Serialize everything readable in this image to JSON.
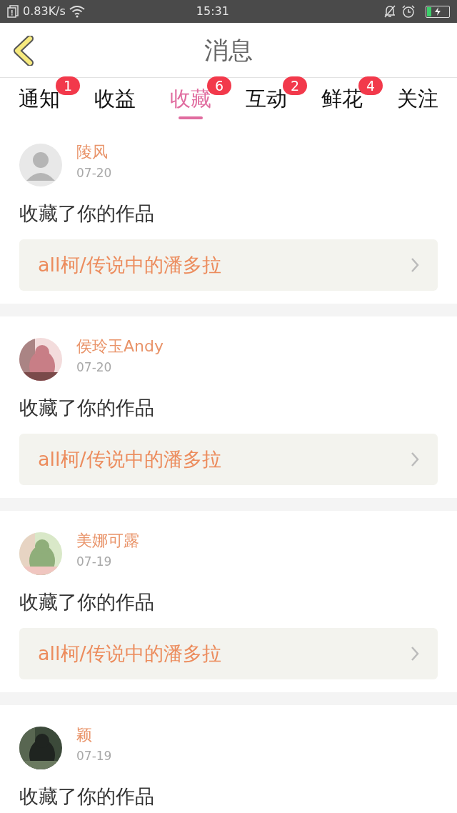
{
  "status_bar": {
    "speed": "0.83K/s",
    "time": "15:31"
  },
  "header": {
    "title": "消息"
  },
  "tabs": [
    {
      "label": "通知",
      "badge": "1",
      "selected": false
    },
    {
      "label": "收益",
      "selected": false
    },
    {
      "label": "收藏",
      "badge": "6",
      "selected": true
    },
    {
      "label": "互动",
      "badge": "2",
      "selected": false
    },
    {
      "label": "鲜花",
      "badge": "4",
      "selected": false
    },
    {
      "label": "关注",
      "selected": false
    }
  ],
  "messages": [
    {
      "avatar": {
        "kind": "silhouette"
      },
      "name": "陵风",
      "date": "07-20",
      "text": "收藏了你的作品",
      "work": "all柯/传说中的潘多拉"
    },
    {
      "name": "侯玲玉Andy",
      "date": "07-20",
      "text": "收藏了你的作品",
      "work": "all柯/传说中的潘多拉"
    },
    {
      "name": "美娜可露",
      "date": "07-19",
      "text": "收藏了你的作品",
      "work": "all柯/传说中的潘多拉"
    },
    {
      "name": "颖",
      "date": "07-19",
      "text": "收藏了你的作品"
    }
  ]
}
